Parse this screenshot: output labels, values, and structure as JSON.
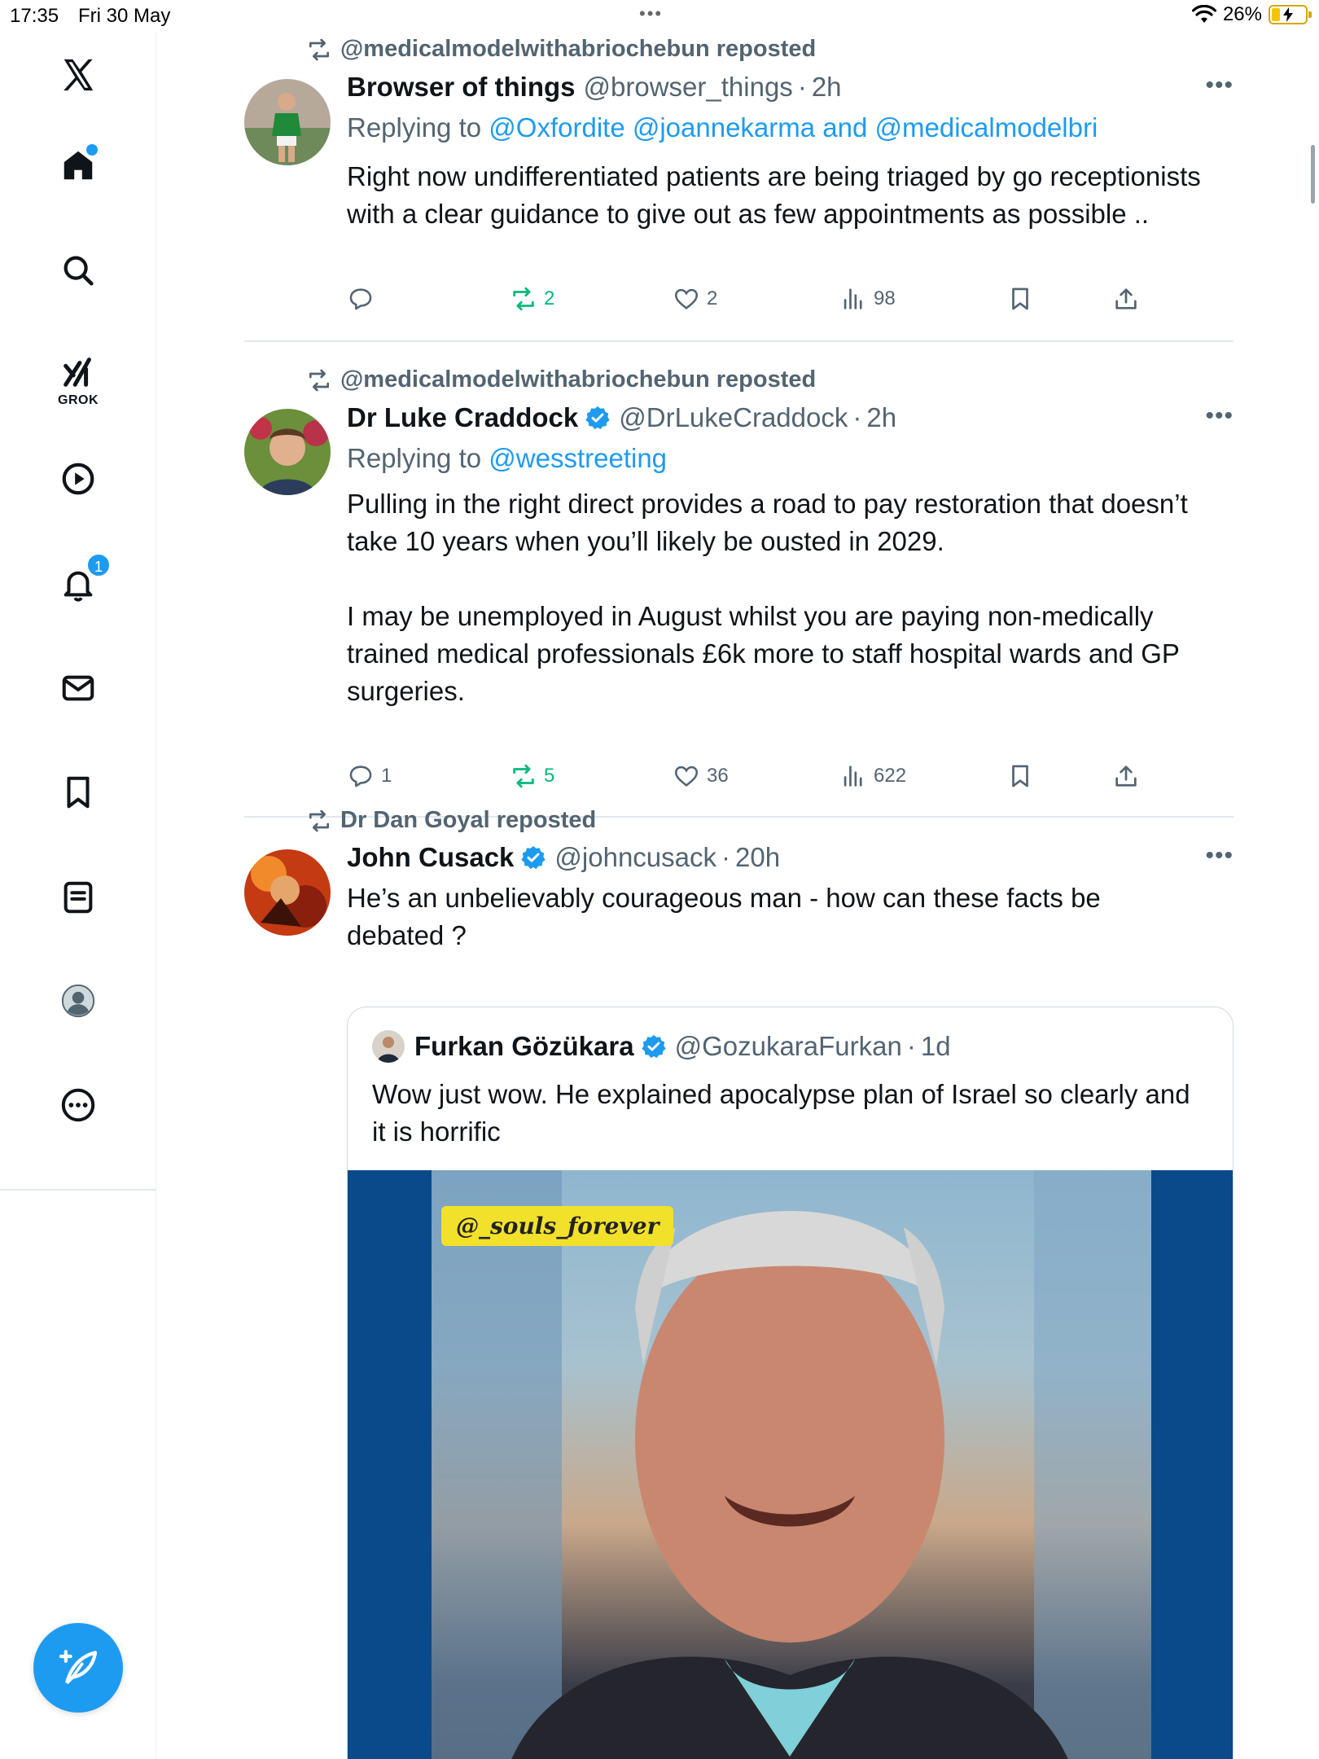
{
  "status_bar": {
    "time": "17:35",
    "date": "Fri 30 May",
    "battery_percent": "26%",
    "battery_level": 0.26,
    "icons": [
      "wifi-icon",
      "battery-charging-icon"
    ]
  },
  "sidebar": {
    "items": [
      {
        "name": "x-logo",
        "icon": "x-logo-icon"
      },
      {
        "name": "home",
        "icon": "home-icon",
        "has_dot": true
      },
      {
        "name": "explore",
        "icon": "search-icon"
      },
      {
        "name": "grok",
        "icon": "grok-icon",
        "label": "GROK"
      },
      {
        "name": "video",
        "icon": "play-icon"
      },
      {
        "name": "notifications",
        "icon": "bell-icon",
        "badge": "1"
      },
      {
        "name": "messages",
        "icon": "mail-icon"
      },
      {
        "name": "bookmarks",
        "icon": "bookmark-icon"
      },
      {
        "name": "lists",
        "icon": "list-icon"
      },
      {
        "name": "profile",
        "icon": "avatar-icon"
      },
      {
        "name": "more",
        "icon": "more-circle-icon"
      }
    ],
    "compose_icon": "compose-icon",
    "accent": "#1d9bf0"
  },
  "posts": [
    {
      "repost_by": "@medicalmodelwithabriochebun reposted",
      "name": "Browser of things",
      "handle": "@browser_things",
      "sep": "·",
      "time": "2h",
      "verified": false,
      "replying_prefix": "Replying to",
      "replying_mentions": "@Oxfordite @joannekarma and @medicalmodelbri",
      "text": "Right now undifferentiated patients are being triaged by go receptionists with a clear guidance to give out as few appointments as possible ..",
      "stats": {
        "replies": "",
        "reposts": "2",
        "likes": "2",
        "views": "98"
      }
    },
    {
      "repost_by": "@medicalmodelwithabriochebun reposted",
      "name": "Dr Luke Craddock",
      "handle": "@DrLukeCraddock",
      "sep": "·",
      "time": "2h",
      "verified": true,
      "replying_prefix": "Replying to",
      "replying_mentions": "@wesstreeting",
      "text": "Pulling in the right direct provides a road to pay restoration that doesn’t take 10 years when you’ll likely be ousted in 2029.\n\nI may be unemployed in August whilst you are paying non-medically trained medical professionals £6k more to staff hospital wards and GP surgeries.",
      "stats": {
        "replies": "1",
        "reposts": "5",
        "likes": "36",
        "views": "622"
      }
    },
    {
      "repost_by": "Dr Dan Goyal reposted",
      "name": "John Cusack",
      "handle": "@johncusack",
      "sep": "·",
      "time": "20h",
      "verified": true,
      "text": "He’s an   unbelievably courageous  man - how can these facts be debated ?",
      "quote": {
        "name": "Furkan Gözükara",
        "handle": "@GozukaraFurkan",
        "sep": "·",
        "time": "1d",
        "verified": true,
        "text": "Wow just wow. He explained apocalypse plan of Israel so clearly and it is horrific",
        "video_watermark": "@_souls_forever"
      }
    }
  ],
  "more_glyph": "•••",
  "colors": {
    "accent": "#1d9bf0",
    "retweet_green": "#00ba7c",
    "secondary_text": "#536471"
  }
}
